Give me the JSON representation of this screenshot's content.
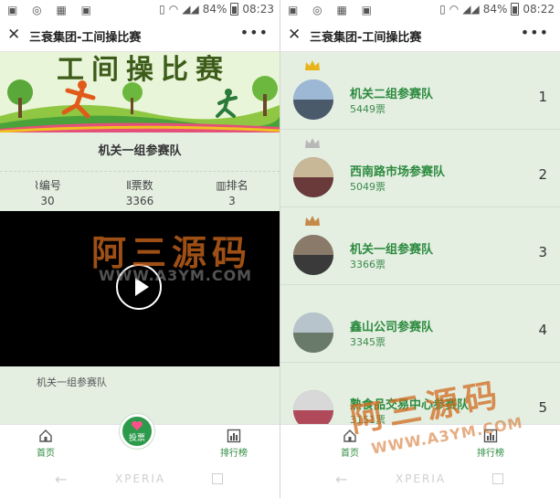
{
  "status_bar": {
    "battery": "84%",
    "time_left": "08:23",
    "time_right": "08:22"
  },
  "app": {
    "title": "三衰集团-工间操比赛"
  },
  "left": {
    "banner_title": "工间操比赛",
    "team_name": "机关一组参赛队",
    "stats": [
      {
        "label": "编号",
        "value": "30",
        "icon": "paperclip-icon"
      },
      {
        "label": "票数",
        "value": "3366",
        "icon": "bar-chart-icon"
      },
      {
        "label": "排名",
        "value": "3",
        "icon": "ranking-chart-icon"
      }
    ],
    "caption": "机关一组参赛队"
  },
  "tabs": {
    "home": "首页",
    "vote": "投票",
    "ranking": "排行榜"
  },
  "system_nav": {
    "brand": "XPERIA"
  },
  "ranking": [
    {
      "rank": "1",
      "name": "机关二组参赛队",
      "votes": "5449票",
      "crown": "gold"
    },
    {
      "rank": "2",
      "name": "西南路市场参赛队",
      "votes": "5049票",
      "crown": "silver"
    },
    {
      "rank": "3",
      "name": "机关一组参赛队",
      "votes": "3366票",
      "crown": "bronze"
    },
    {
      "rank": "4",
      "name": "鑫山公司参赛队",
      "votes": "3345票",
      "crown": ""
    },
    {
      "rank": "5",
      "name": "熟食品交易中心参赛队",
      "votes": "3151票",
      "crown": ""
    }
  ],
  "watermark": {
    "cn": "阿三源码",
    "url": "WWW.A3YM.COM"
  },
  "colors": {
    "accent": "#2c8a3e",
    "background": "#e4efe2",
    "gold": "#e8b41a",
    "silver": "#b8b8b8",
    "bronze": "#c58a4a",
    "watermark": "#d2691e"
  }
}
